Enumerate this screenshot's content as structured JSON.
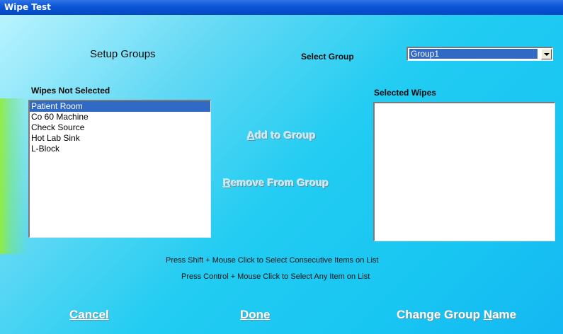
{
  "window": {
    "title": "Wipe Test"
  },
  "header": {
    "setup_title": "Setup Groups",
    "select_group_label": "Select Group",
    "group_select": {
      "value": "Group1"
    }
  },
  "wipes_not_selected": {
    "label": "Wipes Not Selected",
    "items": [
      "Patient Room",
      "Co 60 Machine",
      "Check Source",
      "Hot Lab Sink",
      "L-Block"
    ],
    "selected_index": 0
  },
  "selected_wipes": {
    "label": "Selected Wipes",
    "items": []
  },
  "actions": {
    "add_to_group": "Add to Group",
    "remove_from_group": "Remove From Group"
  },
  "hints": {
    "line1": "Press Shift + Mouse Click to Select Consecutive Items on List",
    "line2": "Press Control + Mouse Click to Select Any Item on List"
  },
  "footer": {
    "cancel": "Cancel",
    "done": "Done",
    "change_group_name": "Change Group Name"
  }
}
